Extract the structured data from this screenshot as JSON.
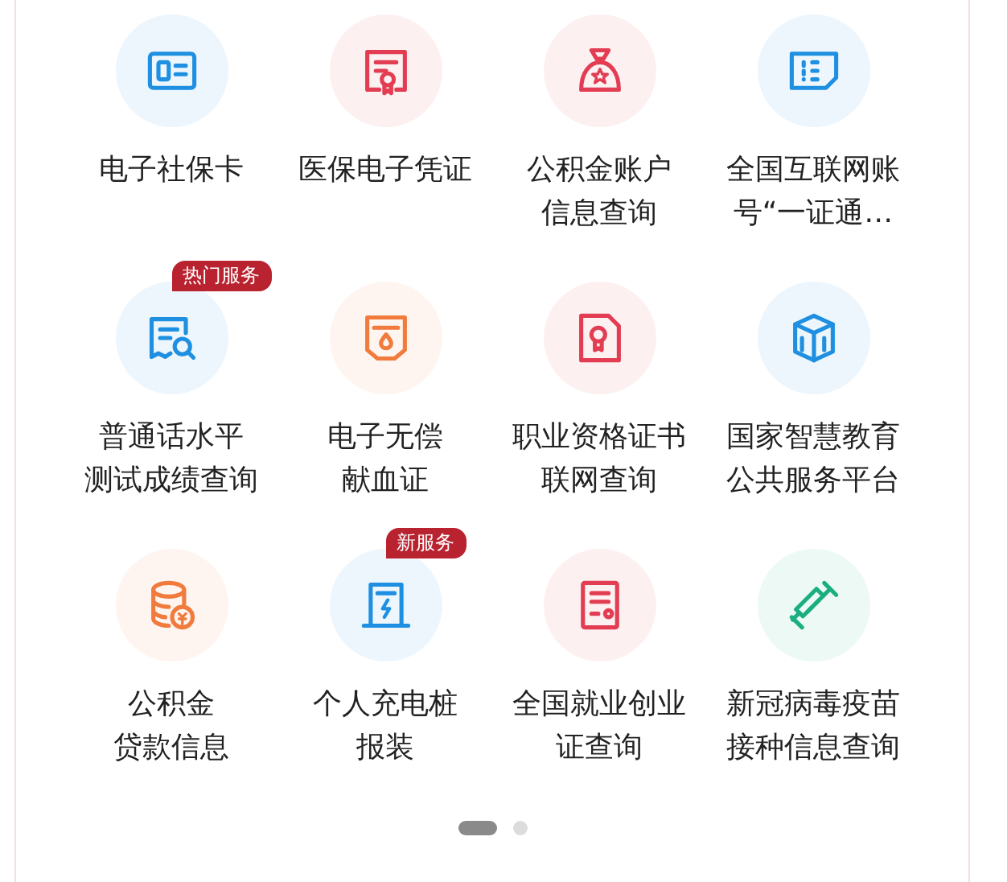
{
  "services": [
    {
      "color": "#1e8fe1",
      "lines": [
        "电子社保卡"
      ]
    },
    {
      "color": "#e23d52",
      "lines": [
        "医保电子凭证"
      ]
    },
    {
      "color": "#e23d52",
      "lines": [
        "公积金账户",
        "信息查询"
      ]
    },
    {
      "color": "#1e8fe1",
      "lines": [
        "全国互联网账",
        "号“一证通…"
      ]
    },
    {
      "color": "#1e8fe1",
      "badge": "热门服务",
      "lines": [
        "普通话水平",
        "测试成绩查询"
      ]
    },
    {
      "color": "#f07b3c",
      "lines": [
        "电子无偿",
        "献血证"
      ]
    },
    {
      "color": "#e23d52",
      "lines": [
        "职业资格证书",
        "联网查询"
      ]
    },
    {
      "color": "#1e8fe1",
      "lines": [
        "国家智慧教育",
        "公共服务平台"
      ]
    },
    {
      "color": "#f07b3c",
      "lines": [
        "公积金",
        "贷款信息"
      ]
    },
    {
      "color": "#1e8fe1",
      "badge": "新服务",
      "lines": [
        "个人充电桩",
        "报装"
      ]
    },
    {
      "color": "#e23d52",
      "lines": [
        "全国就业创业",
        "证查询"
      ]
    },
    {
      "color": "#1aae80",
      "lines": [
        "新冠病毒疫苗",
        "接种信息查询"
      ]
    }
  ],
  "pages": [
    {
      "selected": true
    },
    {
      "selected": false
    }
  ]
}
